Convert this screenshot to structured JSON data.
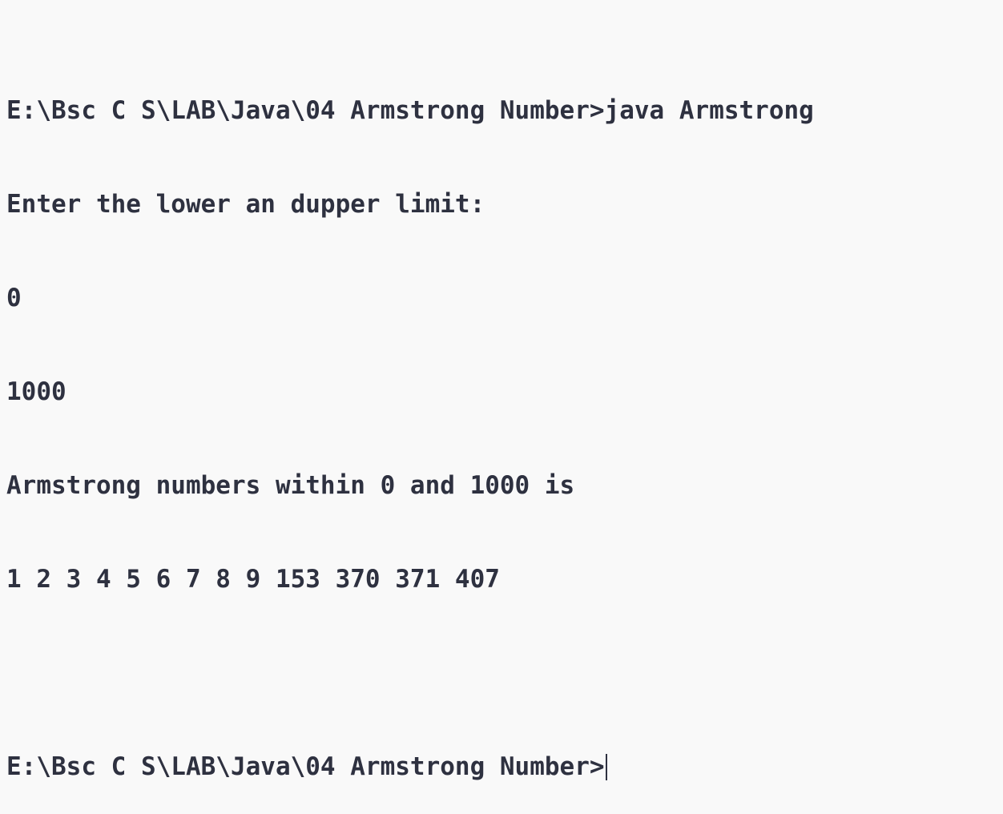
{
  "console": {
    "lines": [
      "E:\\Bsc C S\\LAB\\Java\\04 Armstrong Number>java Armstrong",
      "Enter the lower an dupper limit:",
      "0",
      "1000",
      "Armstrong numbers within 0 and 1000 is",
      "1 2 3 4 5 6 7 8 9 153 370 371 407",
      ""
    ],
    "prompt": "E:\\Bsc C S\\LAB\\Java\\04 Armstrong Number>",
    "colors": {
      "background": "#f9f9f9",
      "text": "#2e3140"
    }
  }
}
